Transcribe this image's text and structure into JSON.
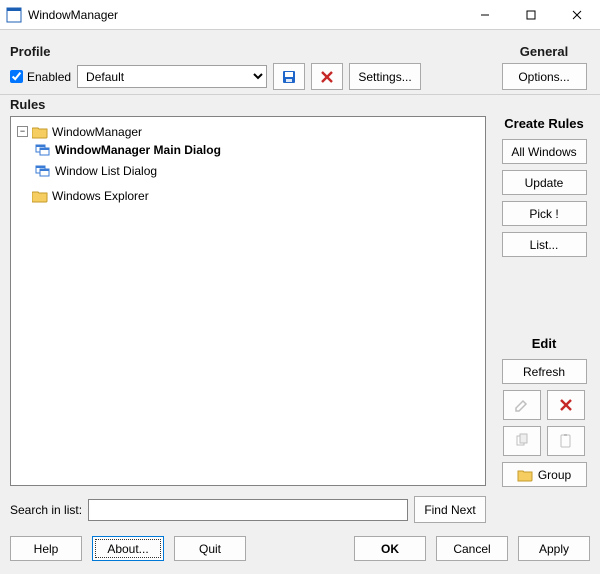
{
  "window": {
    "title": "WindowManager"
  },
  "profile": {
    "label": "Profile",
    "enabled_label": "Enabled",
    "enabled_checked": true,
    "selected": "Default",
    "options": [
      "Default"
    ],
    "settings_label": "Settings..."
  },
  "general": {
    "label": "General",
    "options_label": "Options..."
  },
  "rules": {
    "label": "Rules",
    "tree": {
      "root1": {
        "label": "WindowManager",
        "expanded": true
      },
      "root1_children": [
        {
          "label": "WindowManager Main Dialog",
          "bold": true
        },
        {
          "label": "Window List Dialog",
          "bold": false
        }
      ],
      "root2": {
        "label": "Windows Explorer",
        "expanded": false
      }
    },
    "search_label": "Search in list:",
    "search_value": "",
    "find_next_label": "Find Next"
  },
  "create_rules": {
    "label": "Create Rules",
    "all_windows": "All Windows",
    "update": "Update",
    "pick": "Pick !",
    "list": "List..."
  },
  "edit": {
    "label": "Edit",
    "refresh": "Refresh",
    "group": "Group"
  },
  "bottom": {
    "help": "Help",
    "about": "About...",
    "quit": "Quit",
    "ok": "OK",
    "cancel": "Cancel",
    "apply": "Apply"
  },
  "icons": {
    "save": "save-icon",
    "delete_profile": "x-icon",
    "edit_rule": "pencil-icon",
    "delete_rule": "x-icon",
    "copy": "copy-icon",
    "paste": "paste-icon",
    "group_folder": "folder-icon"
  }
}
